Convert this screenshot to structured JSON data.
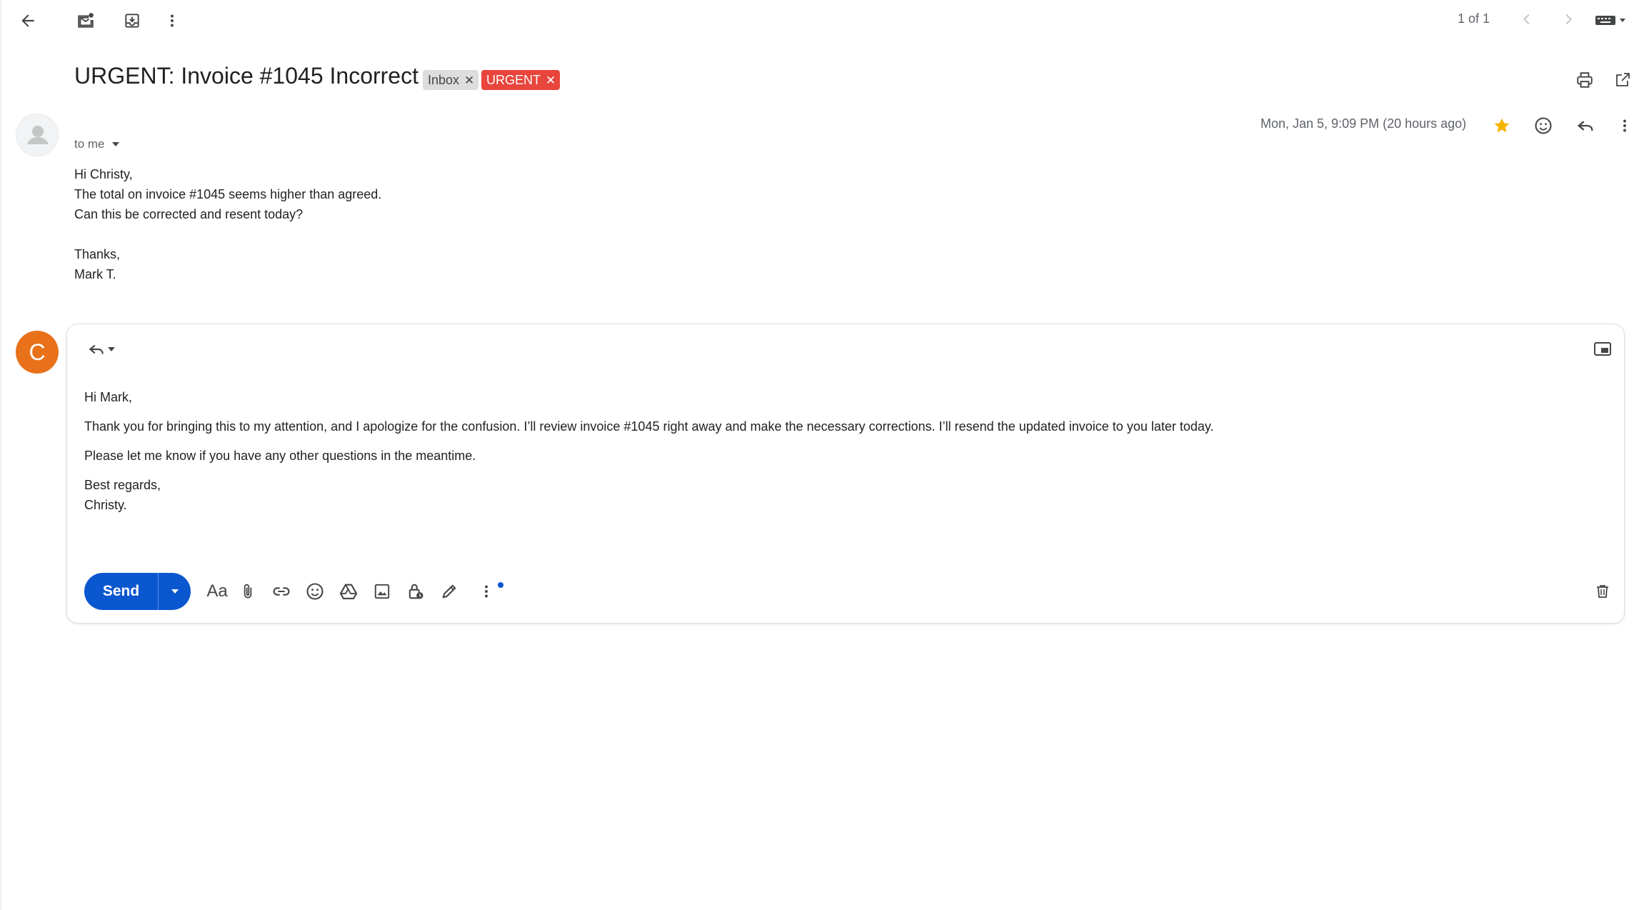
{
  "toolbar": {
    "pager_text": "1 of 1"
  },
  "email": {
    "subject": "URGENT: Invoice #1045 Incorrect",
    "labels": [
      {
        "name": "Inbox",
        "color": "#dddddd"
      },
      {
        "name": "URGENT",
        "color": "#e8453c"
      }
    ],
    "recipient_text": "to me",
    "date_text": "Mon, Jan 5, 9:09 PM (20 hours ago)",
    "starred": true,
    "star_color": "#f4b400",
    "body_lines": [
      "Hi Christy,",
      "The total on invoice #1045 seems higher than agreed.",
      "Can this be corrected and resent today?",
      "",
      "Thanks,",
      "Mark T."
    ]
  },
  "reply": {
    "avatar_initial": "C",
    "avatar_color": "#e8711a",
    "greeting": "Hi Mark,",
    "paragraph1": "Thank you for bringing this to my attention, and I apologize for the confusion. I’ll review invoice #1045 right away and make the necessary corrections. I’ll resend the updated invoice to you later today.",
    "paragraph2": "Please let me know if you have any other questions in the meantime.",
    "closing": "Best regards,",
    "signature": "Christy.",
    "send_label": "Send",
    "formatting_label": "Aa",
    "accent_color": "#0b57d0",
    "icons": [
      "attach-icon",
      "link-icon",
      "emoji-icon",
      "drive-icon",
      "photo-icon",
      "confidential-lock-icon",
      "signature-pen-icon",
      "more-options-icon"
    ]
  }
}
